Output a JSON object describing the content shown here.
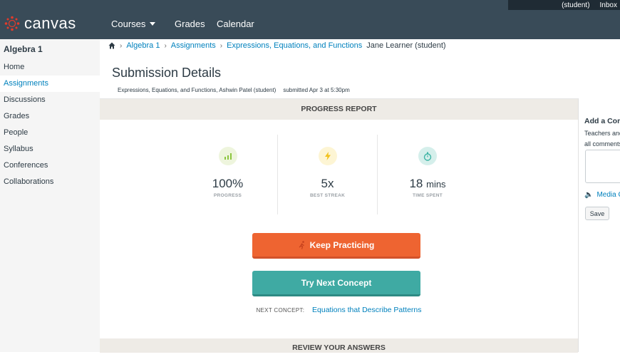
{
  "header": {
    "brand": "canvas",
    "user_label": "(student)",
    "inbox_label": "Inbox",
    "nav": [
      {
        "label": "Courses"
      },
      {
        "label": "Grades"
      },
      {
        "label": "Calendar"
      }
    ]
  },
  "sidebar": {
    "course_title": "Algebra 1",
    "items": [
      {
        "label": "Home",
        "active": false
      },
      {
        "label": "Assignments",
        "active": true
      },
      {
        "label": "Discussions",
        "active": false
      },
      {
        "label": "Grades",
        "active": false
      },
      {
        "label": "People",
        "active": false
      },
      {
        "label": "Syllabus",
        "active": false
      },
      {
        "label": "Conferences",
        "active": false
      },
      {
        "label": "Collaborations",
        "active": false
      }
    ]
  },
  "breadcrumb": {
    "items": [
      "Algebra 1",
      "Assignments",
      "Expressions, Equations, and Functions"
    ],
    "current": "Jane Learner (student)"
  },
  "page": {
    "title": "Submission Details",
    "meta_left": "Expressions, Equations, and Functions, Ashwin Patel (student)",
    "meta_right": "submitted Apr 3 at 5:30pm"
  },
  "report": {
    "heading": "PROGRESS REPORT",
    "stats": [
      {
        "value": "100%",
        "unit": "",
        "label": "PROGRESS",
        "icon": "bar-chart-icon",
        "color": "#8cc63e",
        "bg": "#eef5dd"
      },
      {
        "value": "5x",
        "unit": "",
        "label": "BEST STREAK",
        "icon": "lightning-icon",
        "color": "#f2c21d",
        "bg": "#fdf5d4"
      },
      {
        "value": "18",
        "unit": "mins",
        "label": "TIME SPENT",
        "icon": "stopwatch-icon",
        "color": "#3fb5a5",
        "bg": "#d5efeb"
      }
    ],
    "keep_practicing": "Keep Practicing",
    "try_next": "Try Next Concept",
    "next_concept_label": "NEXT CONCEPT:",
    "next_concept": "Equations that Describe Patterns",
    "review_heading": "REVIEW YOUR ANSWERS"
  },
  "comments": {
    "title": "Add a Comment",
    "text_line1": "Teachers and students see",
    "text_line2": "all comments",
    "media_label": "Media Comment",
    "save_label": "Save"
  },
  "colors": {
    "topbar": "#394b58",
    "link": "#0081bd",
    "orange": "#ee6431",
    "teal": "#3faaa3"
  }
}
